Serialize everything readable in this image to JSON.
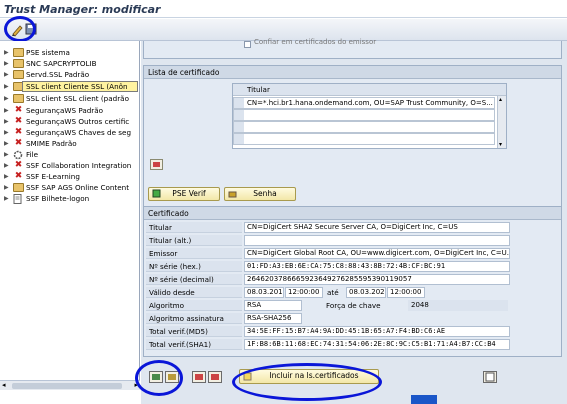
{
  "window": {
    "title": "Trust Manager: modificar"
  },
  "toolbar": {
    "icons": [
      "edit-icon",
      "save-icon"
    ]
  },
  "tree": {
    "items": [
      {
        "label": "PSE sistema",
        "icon": "folder"
      },
      {
        "label": "SNC SAPCRYPTOLIB",
        "icon": "folder"
      },
      {
        "label": "Servd.SSL Padrão",
        "icon": "folder"
      },
      {
        "label": "SSL client Cliente SSL (Anôn",
        "icon": "folder",
        "selected": true
      },
      {
        "label": "SSL client SSL client (padrão",
        "icon": "folder"
      },
      {
        "label": "SegurançaWS Padrão",
        "icon": "error"
      },
      {
        "label": "SegurançaWS Outros certific",
        "icon": "error"
      },
      {
        "label": "SegurançaWS Chaves de seg",
        "icon": "error"
      },
      {
        "label": "SMIME Padrão",
        "icon": "error"
      },
      {
        "label": "File",
        "icon": "gear"
      },
      {
        "label": "SSF Collaboration Integration",
        "icon": "error"
      },
      {
        "label": "SSF E-Learning",
        "icon": "error"
      },
      {
        "label": "SSF SAP AGS Online Content",
        "icon": "folder"
      },
      {
        "label": "SSF Bilhete-logon",
        "icon": "doc"
      }
    ]
  },
  "top_panel": {
    "checkbox_label": "Confiar em certificados do emissor"
  },
  "cert_list": {
    "title": "Lista de certificado",
    "column": "Titular",
    "rows": [
      "CN=*.hci.br1.hana.ondemand.com, OU=SAP Trust Community, O=S...",
      "",
      "",
      "",
      ""
    ]
  },
  "buttons": {
    "pse_verif": "PSE Verif",
    "senha": "Senha",
    "incluir": "Incluir na ls.certificados"
  },
  "certificate": {
    "title": "Certificado",
    "titular_label": "Titular",
    "titular": "CN=DigiCert SHA2 Secure Server CA, O=DigiCert Inc, C=US",
    "titular_alt_label": "Titular (alt.)",
    "titular_alt": "",
    "emissor_label": "Emissor",
    "emissor": "CN=DigiCert Global Root CA, OU=www.digicert.com, O=DigiCert Inc, C=U...",
    "serie_hex_label": "Nº série (hex.)",
    "serie_hex": "01:FD:A3:EB:6E:CA:75:C8:88:43:8B:72:4B:CF:BC:91",
    "serie_dec_label": "Nº série (decimal)",
    "serie_dec": "2646203786665923649276285595390119057",
    "valido_label": "Válido desde",
    "valido_desde_data": "08.03.2013",
    "valido_desde_hora": "12:00:00",
    "ate_label": "até",
    "valido_ate_data": "08.03.2023",
    "valido_ate_hora": "12:00:00",
    "algoritmo_label": "Algoritmo",
    "algoritmo": "RSA",
    "forca_label": "Força de chave",
    "forca": "2048",
    "assinatura_label": "Algoritmo assinatura",
    "assinatura": "RSA-SHA256",
    "md5_label": "Total verif.(MD5)",
    "md5": "34:5E:FF:15:B7:A4:9A:DD:45:1B:65:A7:F4:BD:C6:AE",
    "sha1_label": "Total verif.(SHA1)",
    "sha1": "1F:B8:6B:11:68:EC:74:31:54:06:2E:8C:9C:C5:B1:71:A4:B7:CC:B4"
  },
  "colors": {
    "annotation": "#0a16d8",
    "selected": "#fff3a0",
    "error": "#c62020"
  }
}
